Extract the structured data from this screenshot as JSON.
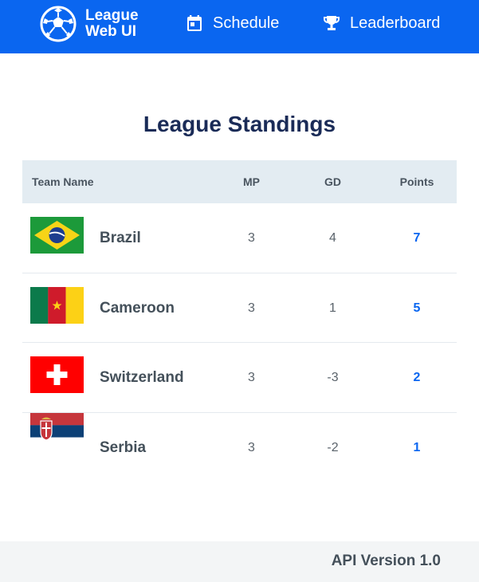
{
  "header": {
    "brand_line1": "League",
    "brand_line2": "Web UI",
    "logo_icon": "soccer-ball-icon",
    "nav": [
      {
        "label": "Schedule",
        "icon": "calendar-icon"
      },
      {
        "label": "Leaderboard",
        "icon": "trophy-icon"
      }
    ],
    "accent_color": "#0a66f0"
  },
  "main": {
    "title": "League Standings",
    "columns": {
      "team": "Team Name",
      "mp": "MP",
      "gd": "GD",
      "points": "Points"
    },
    "rows": [
      {
        "team": "Brazil",
        "flag": "brazil-flag",
        "mp": "3",
        "gd": "4",
        "points": "7"
      },
      {
        "team": "Cameroon",
        "flag": "cameroon-flag",
        "mp": "3",
        "gd": "1",
        "points": "5"
      },
      {
        "team": "Switzerland",
        "flag": "switzerland-flag",
        "mp": "3",
        "gd": "-3",
        "points": "2"
      },
      {
        "team": "Serbia",
        "flag": "serbia-flag",
        "mp": "3",
        "gd": "-2",
        "points": "1"
      }
    ]
  },
  "footer": {
    "api_version": "API Version 1.0"
  }
}
